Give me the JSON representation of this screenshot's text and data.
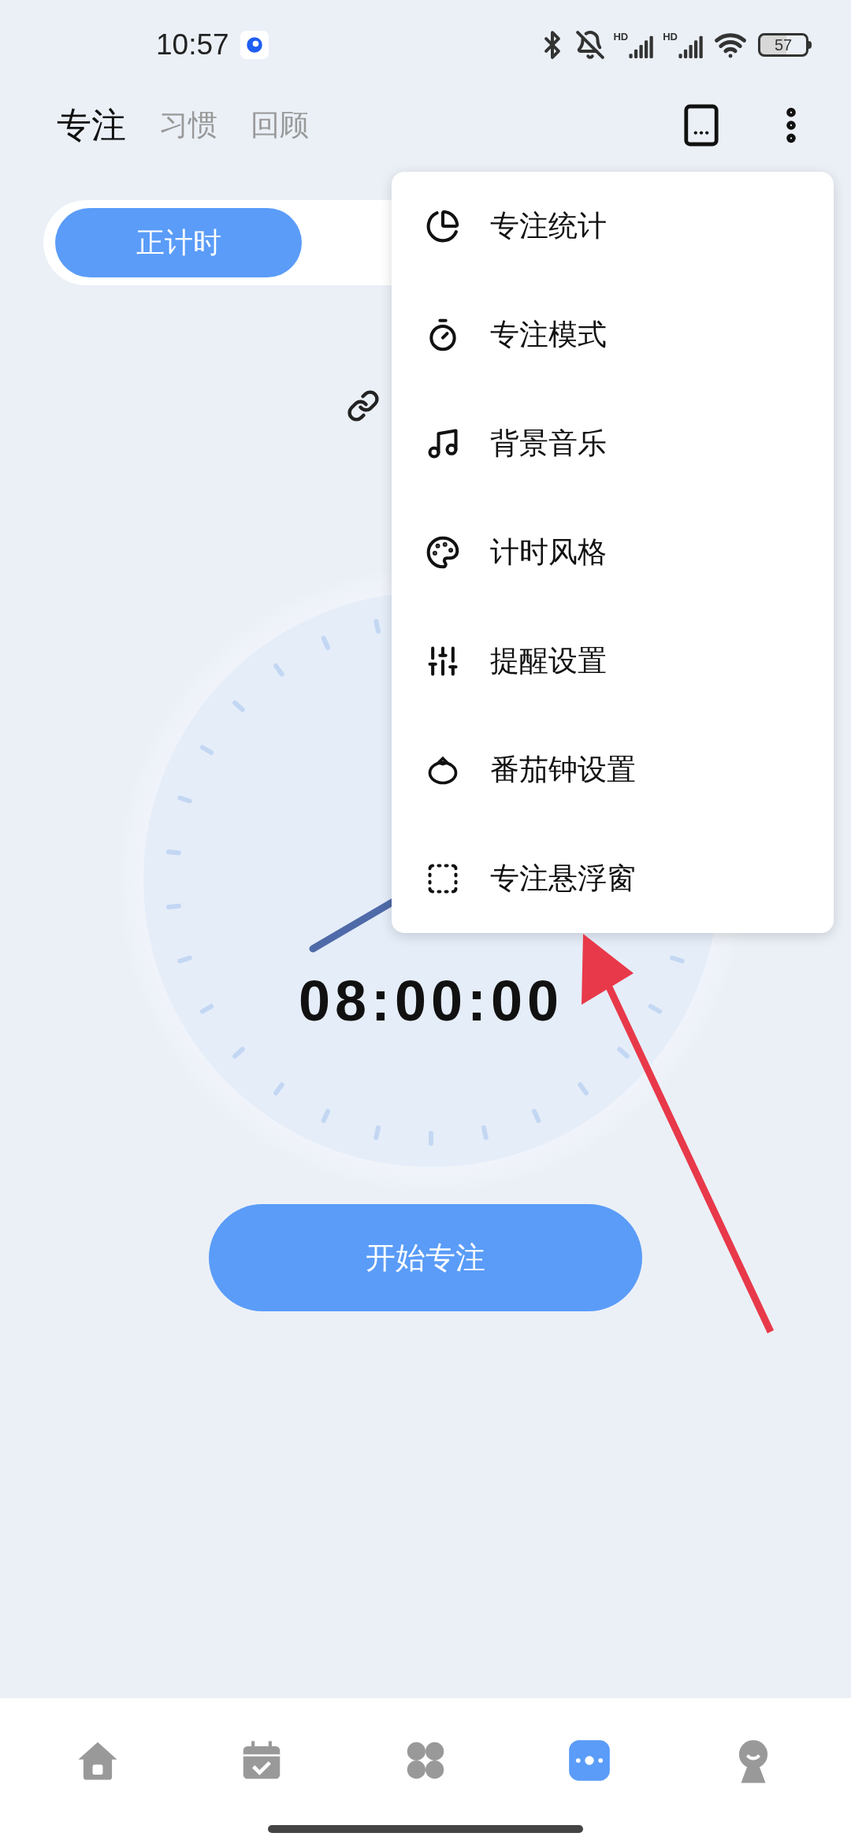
{
  "status_bar": {
    "time": "10:57",
    "sim_1": "HD",
    "sim_2": "HD",
    "battery": "57"
  },
  "header_tabs": [
    {
      "label": "专注",
      "selected": true
    },
    {
      "label": "习惯",
      "selected": false
    },
    {
      "label": "回顾",
      "selected": false
    }
  ],
  "timer_modes": [
    {
      "label": "正计时",
      "selected": true
    }
  ],
  "timer": {
    "display": "08:00:00"
  },
  "start_button": "开始专注",
  "menu": [
    {
      "kind": "stats",
      "label": "专注统计"
    },
    {
      "kind": "mode",
      "label": "专注模式"
    },
    {
      "kind": "music",
      "label": "背景音乐"
    },
    {
      "kind": "style",
      "label": "计时风格"
    },
    {
      "kind": "reminder",
      "label": "提醒设置"
    },
    {
      "kind": "tomato",
      "label": "番茄钟设置"
    },
    {
      "kind": "float",
      "label": "专注悬浮窗"
    }
  ],
  "bottom_nav": [
    {
      "kind": "home",
      "selected": false
    },
    {
      "kind": "calendar",
      "selected": false
    },
    {
      "kind": "apps",
      "selected": false
    },
    {
      "kind": "focus",
      "selected": true
    },
    {
      "kind": "profile",
      "selected": false
    }
  ]
}
